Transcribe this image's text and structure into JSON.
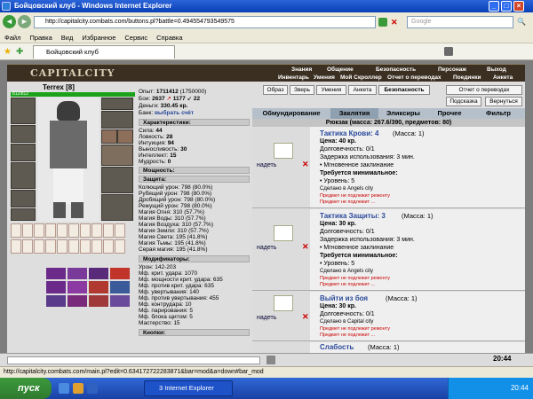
{
  "window": {
    "title": "Бойцовский клуб - Windows Internet Explorer",
    "url": "http://capitalcity.combats.com/buttons.pl?battle=0.494554793549575",
    "search_placeholder": "Google",
    "tab_title": "Бойцовский клуб",
    "status_url": "http://capitalcity.combats.com/main.pl?edit=0.634172722283871&bar=mod&a=down#bar_mod",
    "menu": [
      "Файл",
      "Правка",
      "Вид",
      "Избранное",
      "Сервис",
      "Справка"
    ]
  },
  "game_header": {
    "logo": "CAPITALCITY",
    "menu_top": [
      "Знания",
      "Общение",
      "Безопасность",
      "Персонаж",
      "Выход"
    ],
    "menu_bottom": [
      "Инвентарь",
      "Умения",
      "Мой Скроллер",
      "Отчет о переводах",
      "Поединки",
      "Анкета"
    ]
  },
  "character": {
    "name": "Terrex",
    "level": "[8]",
    "hp": "812/812",
    "experience_label": "Опыт:",
    "experience": "1711412",
    "experience_next": "(1750000)",
    "battles_label": "Бои:",
    "battles": "2637",
    "wins": "1177",
    "draws": "22",
    "money_label": "Деньги:",
    "money": "330.45 кр.",
    "bank_label": "Банк:",
    "bank": "выбрать счёт",
    "sections": {
      "stats": "Характеристики:",
      "power": "Мощность:",
      "protection": "Защита:",
      "modifiers": "Модификаторы:",
      "buttons": "Кнопки:"
    },
    "stats": [
      {
        "label": "Сила:",
        "value": "44"
      },
      {
        "label": "Ловкость:",
        "value": "28"
      },
      {
        "label": "Интуиция:",
        "value": "94"
      },
      {
        "label": "Выносливость:",
        "value": "30"
      },
      {
        "label": "Интеллект:",
        "value": "15"
      },
      {
        "label": "Мудрость:",
        "value": "0"
      }
    ],
    "protection": [
      "Колющий урон: 798 (80.0%)",
      "Рубящий урон: 798 (80.0%)",
      "Дробящий урон: 798 (80.0%)",
      "Режущий урон: 798 (80.0%)",
      "Магия Огня: 310 (57.7%)",
      "Магия Воды: 310 (57.7%)",
      "Магия Воздуха: 310 (57.7%)",
      "Магия Земли: 310 (57.7%)",
      "Магия Света: 195 (41.8%)",
      "Магия Тьмы: 195 (41.8%)",
      "Серая магия: 195 (41.8%)"
    ],
    "modifiers": [
      "Урон: 142-203",
      "Мф. крит. удара: 1070",
      "Мф. мощности крит. удара: 635",
      "Мф. против крит. удара: 635",
      "Мф. увертывания: 140",
      "Мф. против увертывания: 455",
      "Мф. контрудара: 10",
      "Мф. парирования: 5",
      "Мф. блока щитом: 5",
      "Мастерство: 15"
    ]
  },
  "top_buttons": [
    "Образ",
    "Зверь",
    "Умения",
    "Анкета",
    "Безопасность",
    "Отчет о переводах",
    "Подсказка",
    "Вернуться"
  ],
  "inventory": {
    "tabs": [
      "Обмундирование",
      "Заклятия",
      "Эликсиры",
      "Прочее",
      "Фильтр"
    ],
    "active_tab": "Заклятия",
    "title": "Рюкзак (масса: 267.6/390, предметов: 80)",
    "equip_label": "надеть",
    "items": [
      {
        "name": "Тактика Крови: 4",
        "mass": "(Масса: 1)",
        "price": "Цена: 40 кр.",
        "durability": "Долговечность: 0/1",
        "delay": "Задержка использования: 3 мин.",
        "kind": "• Мгновенное заклинание",
        "req_title": "Требуется минимальное:",
        "req": "• Уровень: 5",
        "made": "Сделано в Angels city",
        "notes": [
          "Предмет не подлежит ремонту",
          "Предмет не подлежит ..."
        ]
      },
      {
        "name": "Тактика Защиты: 3",
        "mass": "(Масса: 1)",
        "price": "Цена: 30 кр.",
        "durability": "Долговечность: 0/1",
        "delay": "Задержка использования: 3 мин.",
        "kind": "• Мгновенное заклинание",
        "req_title": "Требуется минимальное:",
        "req": "• Уровень: 5",
        "made": "Сделано в Angels city",
        "notes": [
          "Предмет не подлежит ремонту",
          "Предмет не подлежит ..."
        ]
      },
      {
        "name": "Выйти из боя",
        "mass": "(Масса: 1)",
        "price": "Цена: 30 кр.",
        "durability": "Долговечность: 0/1",
        "made": "Сделано в Capital city",
        "notes": [
          "Предмет не подлежит ремонту",
          "Предмет не подлежит ..."
        ]
      },
      {
        "name": "Слабость",
        "mass": "(Масса: 1)"
      }
    ]
  },
  "taskbar": {
    "start": "пуск",
    "window_button": "3 Internet Explorer",
    "clock": "20:44"
  },
  "colors": {
    "titlebar": "#0a3fb6",
    "game_bg": "#dedede",
    "item_link": "#2a4a9a",
    "taskbar": "#1941a5",
    "start_button": "#2f7a2f"
  }
}
